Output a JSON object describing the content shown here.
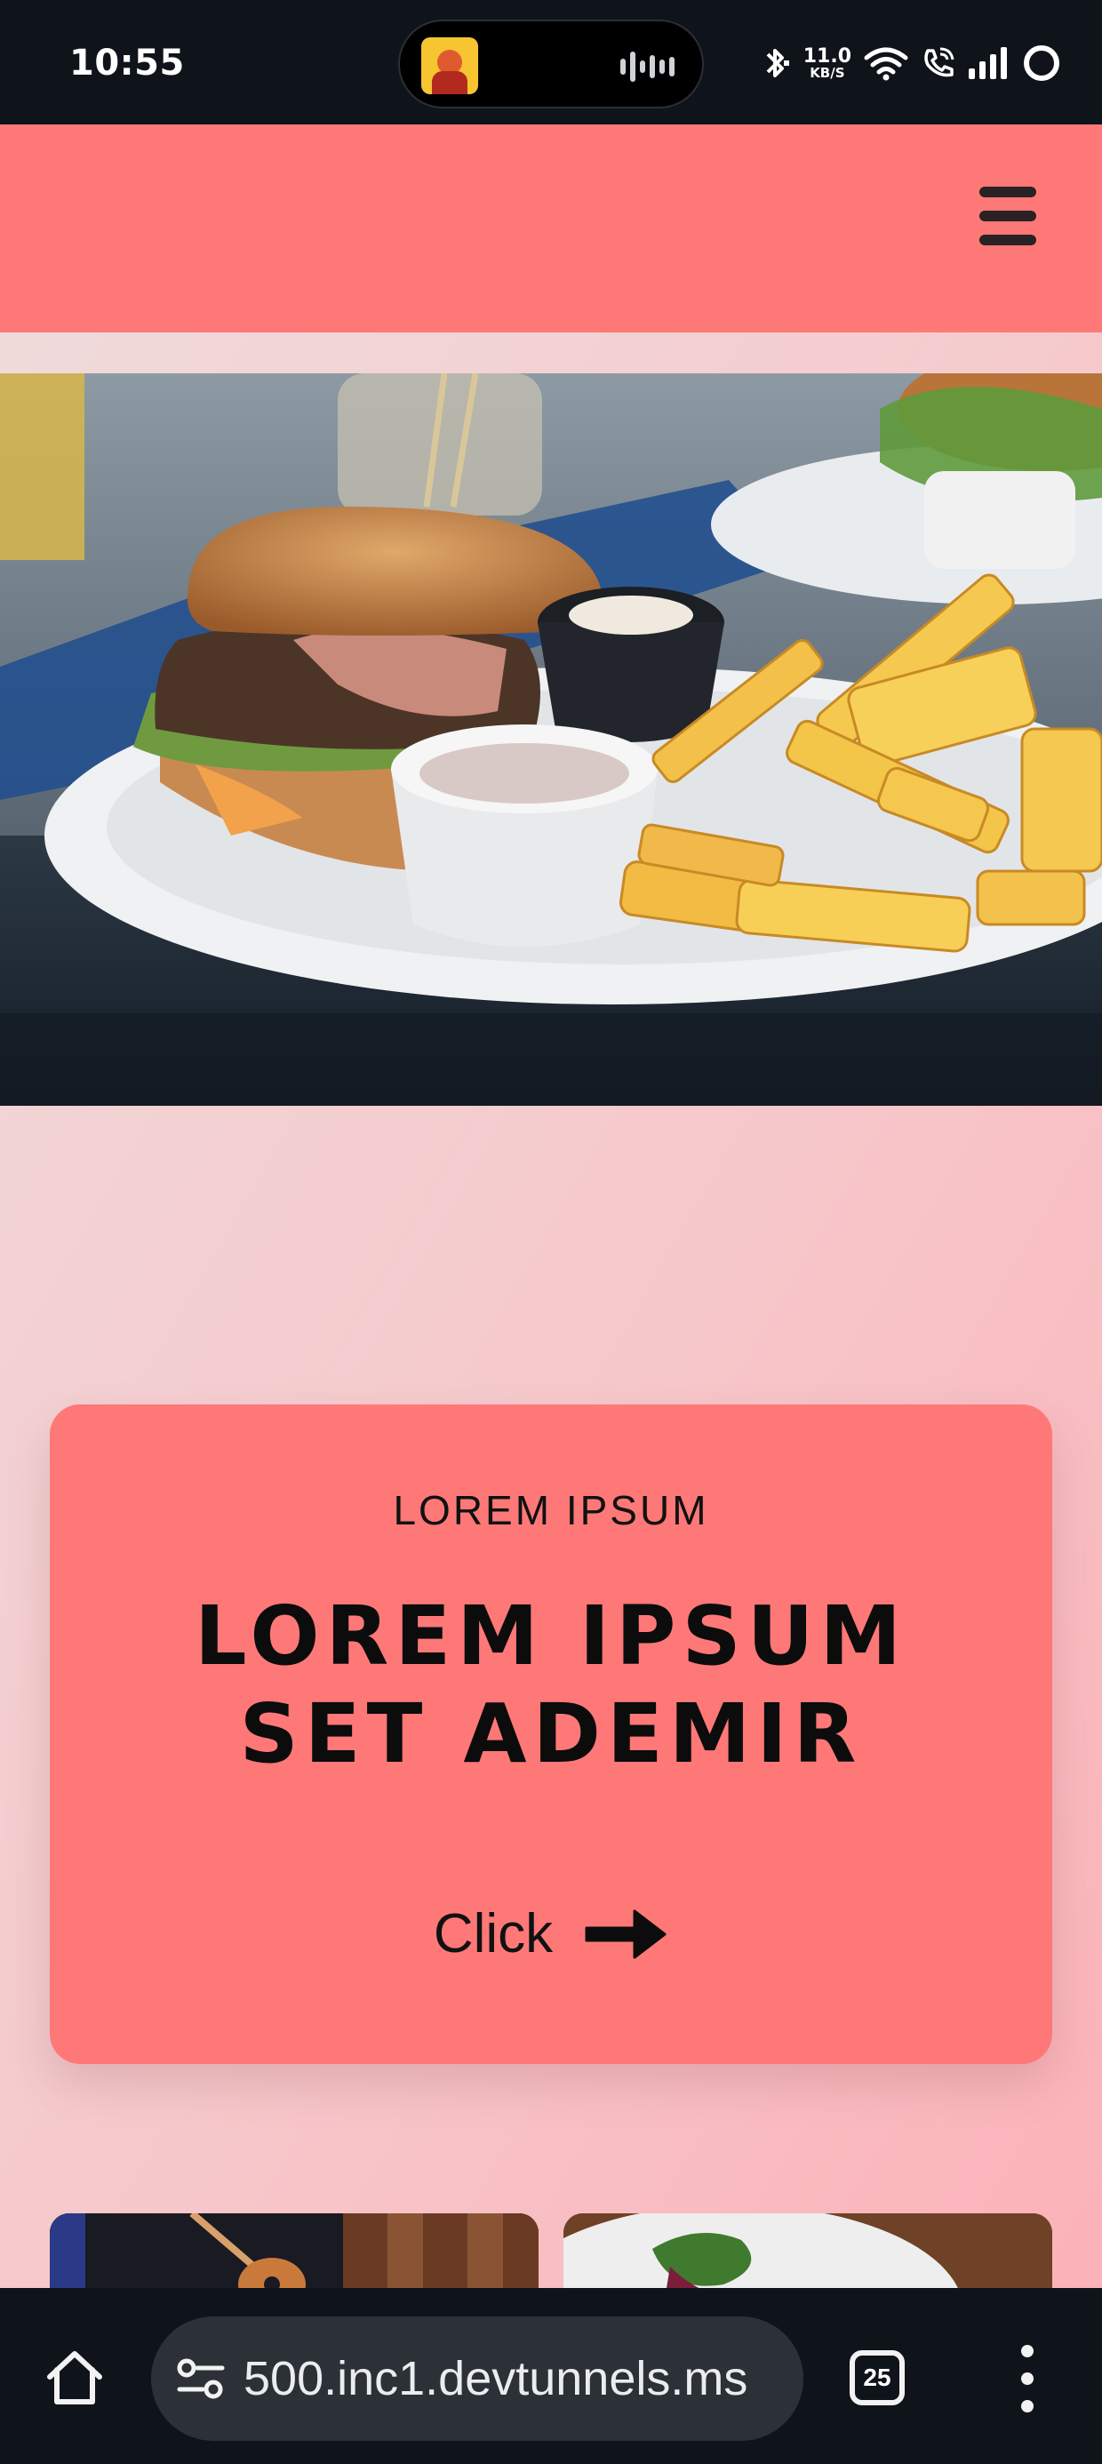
{
  "status_bar": {
    "time": "10:55",
    "net_speed_value": "11.0",
    "net_speed_unit": "KB/S",
    "icons": [
      "now-playing-art",
      "audio-wave-icon",
      "bluetooth-icon",
      "wifi-icon",
      "wifi-call-icon",
      "signal-icon",
      "battery-ring-icon"
    ]
  },
  "header": {
    "menu_icon": "hamburger-icon",
    "background": "#ff7878"
  },
  "hero": {
    "image": "burger-and-fries-photo"
  },
  "promo": {
    "eyebrow": "LOREM IPSUM",
    "title_line1": "LOREM IPSUM",
    "title_line2": "SET ADEMIR",
    "cta_label": "Click",
    "cta_icon": "arrow-right-icon",
    "background": "#ff7878"
  },
  "thumbnails": [
    "guitar-photo",
    "plated-dish-photo"
  ],
  "browser": {
    "url": "500.inc1.devtunnels.ms",
    "tab_count": "25",
    "icons": [
      "home-icon",
      "site-settings-icon",
      "more-menu-icon"
    ]
  },
  "colors": {
    "accent": "#ff7878",
    "system_bar": "#0f131a",
    "page_background_from": "#efdcdc",
    "page_background_to": "#fbb2b8"
  }
}
